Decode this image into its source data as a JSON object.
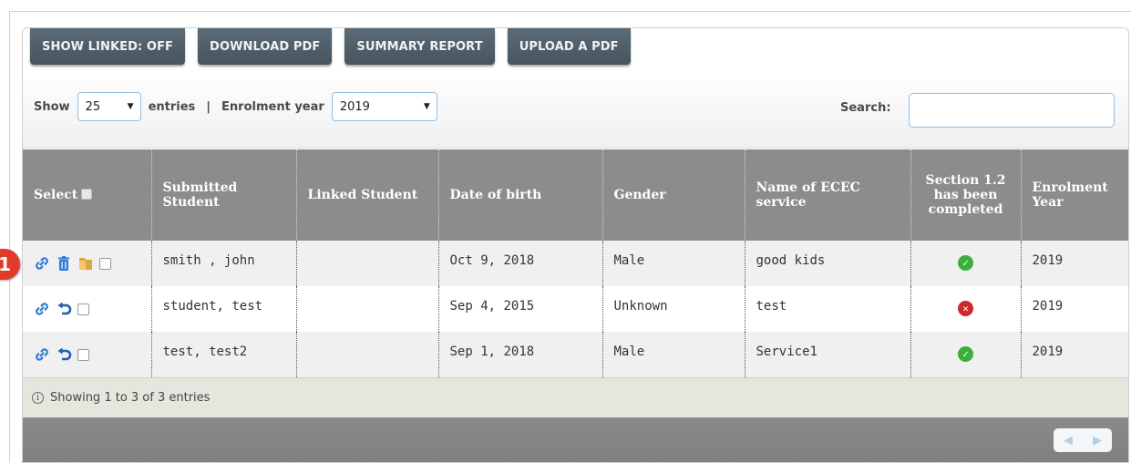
{
  "toolbar": {
    "buttons": [
      "SHOW LINKED: OFF",
      "DOWNLOAD PDF",
      "SUMMARY REPORT",
      "UPLOAD A PDF"
    ]
  },
  "filters": {
    "show_label": "Show",
    "page_size": "25",
    "entries_label": "entries",
    "separator": "|",
    "enrolment_year_label": "Enrolment year",
    "enrolment_year": "2019",
    "search_label": "Search:",
    "search_value": ""
  },
  "table": {
    "headers": [
      "Select",
      "Submitted Student",
      "Linked Student",
      "Date of birth",
      "Gender",
      "Name of ECEC service",
      "Section 1.2 has been completed",
      "Enrolment Year"
    ],
    "rows": [
      {
        "actions": [
          "link-icon",
          "trash-icon",
          "folder-icon"
        ],
        "submitted": "smith , john",
        "linked": "",
        "dob": "Oct 9, 2018",
        "gender": "Male",
        "service": "good kids",
        "completed": "check-icon",
        "year": "2019"
      },
      {
        "actions": [
          "link-icon",
          "undo-icon"
        ],
        "submitted": "student, test",
        "linked": "",
        "dob": "Sep 4, 2015",
        "gender": "Unknown",
        "service": "test",
        "completed": "cross-icon",
        "year": "2019"
      },
      {
        "actions": [
          "link-icon",
          "undo-icon"
        ],
        "submitted": "test, test2",
        "linked": "",
        "dob": "Sep 1, 2018",
        "gender": "Male",
        "service": "Service1",
        "completed": "check-icon",
        "year": "2019"
      }
    ]
  },
  "info": {
    "text": "Showing 1 to 3 of 3 entries"
  },
  "annotation": {
    "marker": "1"
  },
  "colors": {
    "toolbar_button": "#4f5f6a",
    "header": "#8c8c8c",
    "check": "#3cae3c",
    "cross": "#cc2a2a",
    "marker": "#e23a2a"
  }
}
